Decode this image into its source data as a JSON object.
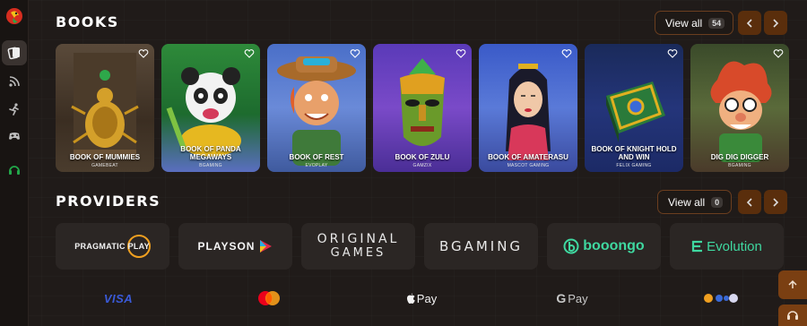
{
  "books_section": {
    "title": "Books",
    "view_all_label": "View all",
    "view_all_count": "54"
  },
  "books": [
    {
      "name": "Book of Mummies",
      "provider": "Gamebeat"
    },
    {
      "name": "Book of Panda Megaways",
      "provider": "BGaming"
    },
    {
      "name": "Book of Rest",
      "provider": "Evoplay"
    },
    {
      "name": "Book of Zulu",
      "provider": "Gamzix"
    },
    {
      "name": "Book of Amaterasu",
      "provider": "Mascot Gaming"
    },
    {
      "name": "Book of Knight Hold and Win",
      "provider": "Felix Gaming"
    },
    {
      "name": "Dig Dig Digger",
      "provider": "BGaming"
    }
  ],
  "providers_section": {
    "title": "Providers",
    "view_all_label": "View all",
    "view_all_count": "0"
  },
  "providers": {
    "pragmatic_a": "PRAGMATIC",
    "pragmatic_b": "PLAY",
    "playson": "PLAYSON",
    "original_a": "ORIGINAL",
    "original_b": "GAMES",
    "bgaming": "BGAMING",
    "booongo": "booongo",
    "evolution": "Evolution"
  },
  "payments": {
    "visa": "VISA",
    "applepay": "Pay",
    "gpay": "Pay"
  },
  "colors": {
    "accent": "#5a2e0c",
    "accent_border": "#6b3e1f",
    "tile_bg": "#2b2624",
    "page_bg": "#201b19"
  }
}
